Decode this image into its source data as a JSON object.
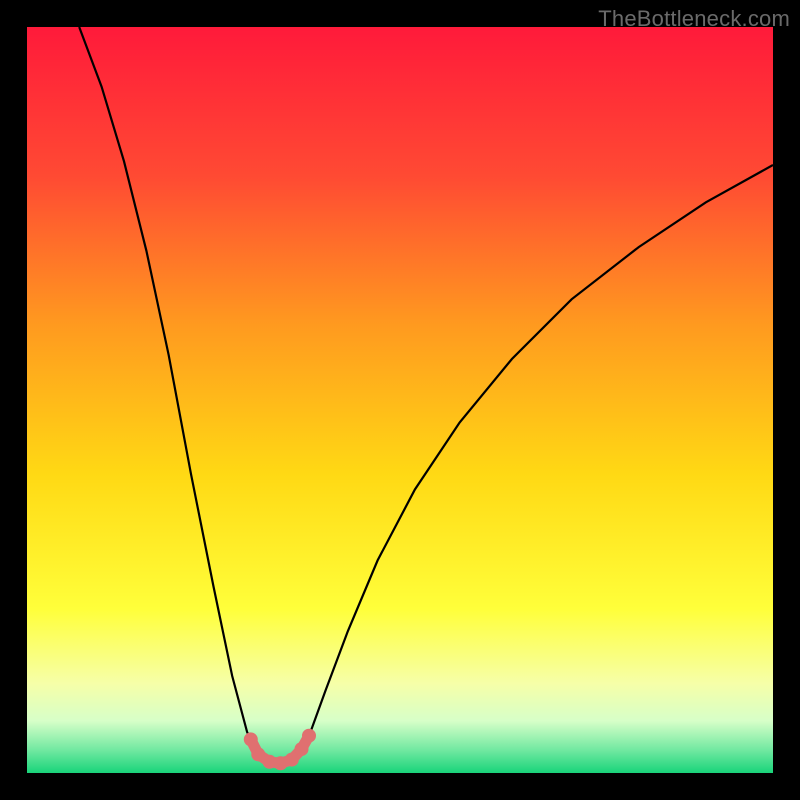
{
  "watermark": "TheBottleneck.com",
  "chart_data": {
    "type": "line",
    "title": "",
    "xlabel": "",
    "ylabel": "",
    "xlim": [
      0,
      1
    ],
    "ylim": [
      0,
      1
    ],
    "gradient_stops": [
      {
        "offset": 0.0,
        "color": "#ff1a3a"
      },
      {
        "offset": 0.2,
        "color": "#ff4a33"
      },
      {
        "offset": 0.4,
        "color": "#ff9a1f"
      },
      {
        "offset": 0.6,
        "color": "#ffd914"
      },
      {
        "offset": 0.78,
        "color": "#ffff3a"
      },
      {
        "offset": 0.88,
        "color": "#f6ffa8"
      },
      {
        "offset": 0.93,
        "color": "#d7ffc8"
      },
      {
        "offset": 0.97,
        "color": "#6fe8a0"
      },
      {
        "offset": 1.0,
        "color": "#19d47a"
      }
    ],
    "series": [
      {
        "name": "bottleneck-curve",
        "color": "#000000",
        "points": [
          {
            "x": 0.07,
            "y": 1.0
          },
          {
            "x": 0.1,
            "y": 0.92
          },
          {
            "x": 0.13,
            "y": 0.82
          },
          {
            "x": 0.16,
            "y": 0.7
          },
          {
            "x": 0.19,
            "y": 0.56
          },
          {
            "x": 0.22,
            "y": 0.4
          },
          {
            "x": 0.25,
            "y": 0.25
          },
          {
            "x": 0.275,
            "y": 0.13
          },
          {
            "x": 0.295,
            "y": 0.055
          },
          {
            "x": 0.305,
            "y": 0.035
          },
          {
            "x": 0.315,
            "y": 0.022
          },
          {
            "x": 0.33,
            "y": 0.014
          },
          {
            "x": 0.345,
            "y": 0.014
          },
          {
            "x": 0.36,
            "y": 0.022
          },
          {
            "x": 0.37,
            "y": 0.035
          },
          {
            "x": 0.38,
            "y": 0.055
          },
          {
            "x": 0.4,
            "y": 0.11
          },
          {
            "x": 0.43,
            "y": 0.19
          },
          {
            "x": 0.47,
            "y": 0.285
          },
          {
            "x": 0.52,
            "y": 0.38
          },
          {
            "x": 0.58,
            "y": 0.47
          },
          {
            "x": 0.65,
            "y": 0.555
          },
          {
            "x": 0.73,
            "y": 0.635
          },
          {
            "x": 0.82,
            "y": 0.705
          },
          {
            "x": 0.91,
            "y": 0.765
          },
          {
            "x": 1.0,
            "y": 0.815
          }
        ]
      },
      {
        "name": "optimum-marker",
        "color": "#e07070",
        "marker_points": [
          {
            "x": 0.3,
            "y": 0.045
          },
          {
            "x": 0.31,
            "y": 0.025
          },
          {
            "x": 0.325,
            "y": 0.015
          },
          {
            "x": 0.34,
            "y": 0.013
          },
          {
            "x": 0.355,
            "y": 0.018
          },
          {
            "x": 0.368,
            "y": 0.032
          },
          {
            "x": 0.378,
            "y": 0.05
          }
        ]
      }
    ]
  }
}
